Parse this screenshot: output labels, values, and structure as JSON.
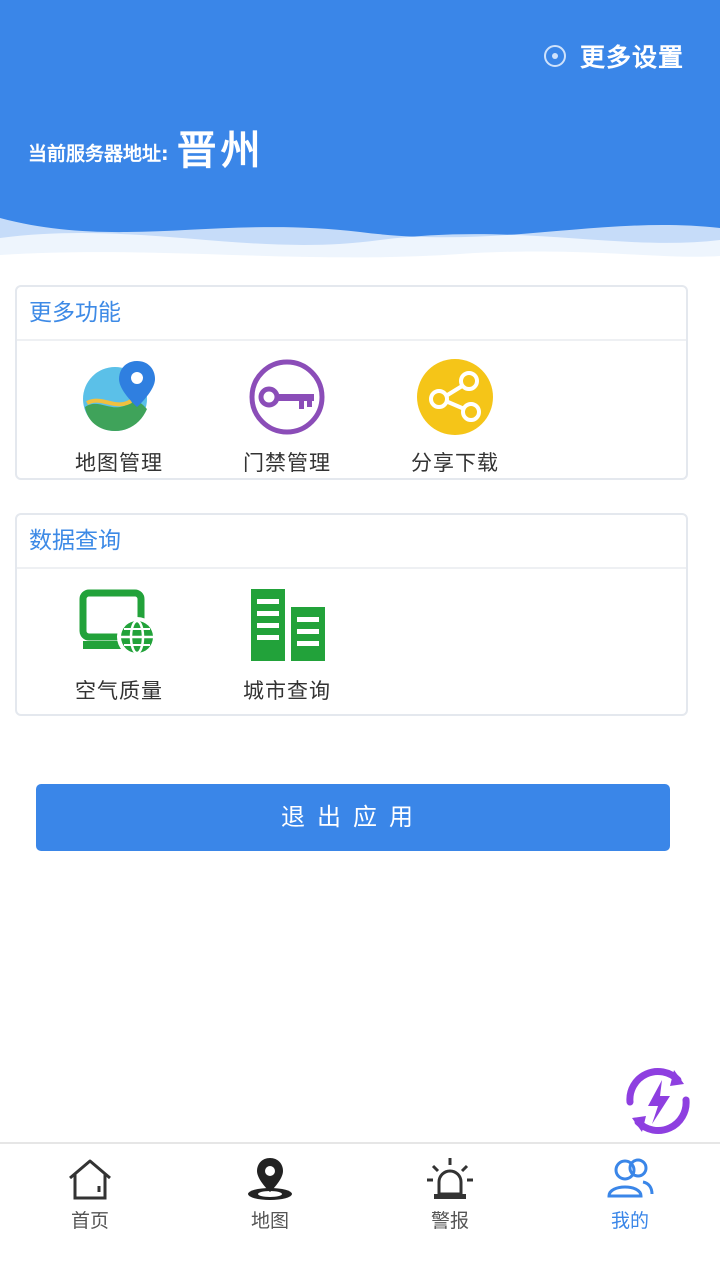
{
  "header": {
    "settings_label": "更多设置",
    "server_label": "当前服务器地址:",
    "server_value": "晋州"
  },
  "more_functions": {
    "title": "更多功能",
    "items": [
      {
        "label": "地图管理",
        "icon": "map-pin-icon"
      },
      {
        "label": "门禁管理",
        "icon": "key-icon"
      },
      {
        "label": "分享下载",
        "icon": "share-icon"
      }
    ]
  },
  "data_query": {
    "title": "数据查询",
    "items": [
      {
        "label": "空气质量",
        "icon": "monitor-globe-icon"
      },
      {
        "label": "城市查询",
        "icon": "buildings-icon"
      }
    ]
  },
  "logout_label": "退出应用",
  "tabbar": {
    "items": [
      {
        "label": "首页",
        "icon": "home-icon"
      },
      {
        "label": "地图",
        "icon": "location-icon"
      },
      {
        "label": "警报",
        "icon": "alarm-icon"
      },
      {
        "label": "我的",
        "icon": "users-icon"
      }
    ],
    "active_index": 3
  },
  "colors": {
    "primary": "#3a86e8",
    "key_purple": "#8b4db8",
    "share_yellow": "#f5c518",
    "green": "#22a23a",
    "fab_purple": "#8e3fe0"
  }
}
